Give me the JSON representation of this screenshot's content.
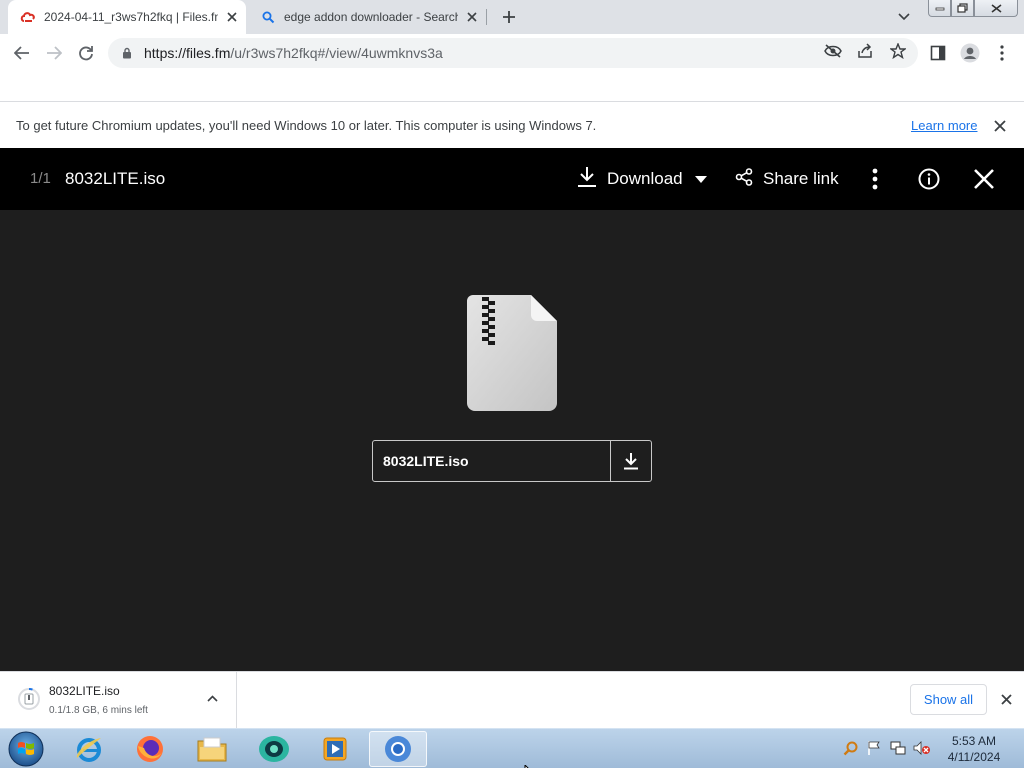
{
  "browser": {
    "tabs": [
      {
        "title": "2024-04-11_r3ws7h2fkq | Files.fm",
        "icon": "filesfm-logo-icon",
        "active": true
      },
      {
        "title": "edge addon downloader - Search",
        "icon": "search-icon",
        "active": false
      }
    ],
    "url_domain": "https://files.fm",
    "url_path": "/u/r3ws7h2fkq#/view/4uwmknvs3a"
  },
  "infobar": {
    "message": "To get future Chromium updates, you'll need Windows 10 or later. This computer is using Windows 7.",
    "link": "Learn more"
  },
  "viewer": {
    "counter": "1/1",
    "filename": "8032LITE.iso",
    "download_label": "Download",
    "share_label": "Share link",
    "file_card_name": "8032LITE.iso"
  },
  "download_shelf": {
    "item_name": "8032LITE.iso",
    "item_status": "0.1/1.8 GB, 6 mins left",
    "show_all": "Show all"
  },
  "taskbar": {
    "time": "5:53 AM",
    "date": "4/11/2024",
    "apps": [
      "internet-explorer-icon",
      "firefox-icon",
      "file-explorer-icon",
      "app-green-icon",
      "media-player-icon",
      "chromium-icon"
    ]
  },
  "colors": {
    "viewer_bg": "#1e1e1e",
    "viewer_header": "#000000",
    "link": "#1a73e8",
    "accent_red": "#d93025"
  }
}
